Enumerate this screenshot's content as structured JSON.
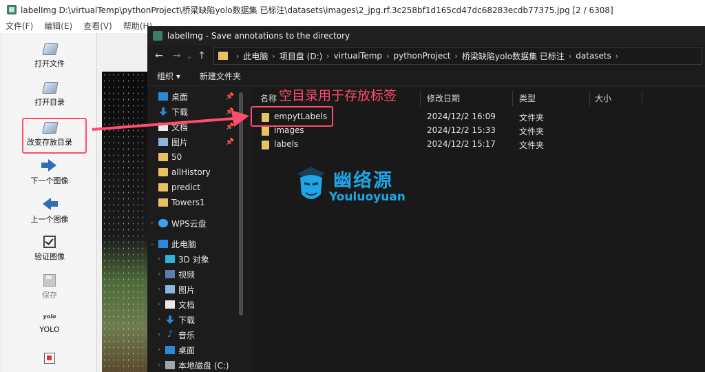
{
  "main_window": {
    "title": "labelImg D:\\virtualTemp\\pythonProject\\桥梁缺陷yolo数据集 已标注\\datasets\\images\\2_jpg.rf.3c258bf1d165cd47dc68283ecdb77375.jpg [2 / 6308]",
    "menu": [
      "文件(F)",
      "编辑(E)",
      "查看(V)",
      "帮助(H)"
    ],
    "tools": [
      {
        "label": "打开文件",
        "icon": "open-file-icon"
      },
      {
        "label": "打开目录",
        "icon": "open-dir-icon"
      },
      {
        "label": "改变存放目录",
        "icon": "change-save-dir-icon"
      },
      {
        "label": "下一个图像",
        "icon": "next-image-icon"
      },
      {
        "label": "上一个图像",
        "icon": "prev-image-icon"
      },
      {
        "label": "验证图像",
        "icon": "verify-icon"
      },
      {
        "label": "保存",
        "icon": "save-icon"
      },
      {
        "label": "YOLO",
        "icon": "yolo-icon",
        "icon_text": "yolo"
      }
    ]
  },
  "dialog": {
    "title": "labelImg - Save annotations to the directory",
    "nav": {
      "back": "←",
      "forward": "→",
      "dropdown": "⌄",
      "up": "↑"
    },
    "address": [
      "此电脑",
      "项目盘 (D:)",
      "virtualTemp",
      "pythonProject",
      "桥梁缺陷yolo数据集 已标注",
      "datasets"
    ],
    "commands": {
      "organize": "组织 ▾",
      "new_folder": "新建文件夹"
    },
    "nav_pane": [
      {
        "label": "桌面",
        "icon": "desktop-icon",
        "pinned": true
      },
      {
        "label": "下载",
        "icon": "download-icon",
        "pinned": true
      },
      {
        "label": "文档",
        "icon": "documents-icon",
        "pinned": true
      },
      {
        "label": "图片",
        "icon": "pictures-icon",
        "pinned": true
      },
      {
        "label": "50",
        "icon": "folder-icon"
      },
      {
        "label": "allHistory",
        "icon": "folder-icon"
      },
      {
        "label": "predict",
        "icon": "folder-icon"
      },
      {
        "label": "Towers1",
        "icon": "folder-icon"
      },
      {
        "label": "WPS云盘",
        "icon": "cloud-icon"
      },
      {
        "label": "此电脑",
        "icon": "computer-icon"
      },
      {
        "label": "3D 对象",
        "icon": "3d-objects-icon"
      },
      {
        "label": "视频",
        "icon": "video-icon"
      },
      {
        "label": "图片",
        "icon": "pictures-icon"
      },
      {
        "label": "文档",
        "icon": "documents-icon"
      },
      {
        "label": "下载",
        "icon": "download-icon"
      },
      {
        "label": "音乐",
        "icon": "music-icon"
      },
      {
        "label": "桌面",
        "icon": "desktop-icon"
      },
      {
        "label": "本地磁盘 (C:)",
        "icon": "disk-icon"
      }
    ],
    "columns": {
      "name": "名称",
      "modified": "修改日期",
      "type": "类型",
      "size": "大小"
    },
    "files": [
      {
        "name": "empytLabels",
        "modified": "2024/12/2 16:09",
        "type": "文件夹"
      },
      {
        "name": "images",
        "modified": "2024/12/2 15:33",
        "type": "文件夹"
      },
      {
        "name": "labels",
        "modified": "2024/12/2 15:17",
        "type": "文件夹"
      }
    ]
  },
  "annotation": {
    "callout": "空目录用于存放标签",
    "color": "#ff4d6a"
  },
  "watermark": {
    "cn": "幽络源",
    "en": "Youluoyuan",
    "color": "#1fa6e6"
  }
}
